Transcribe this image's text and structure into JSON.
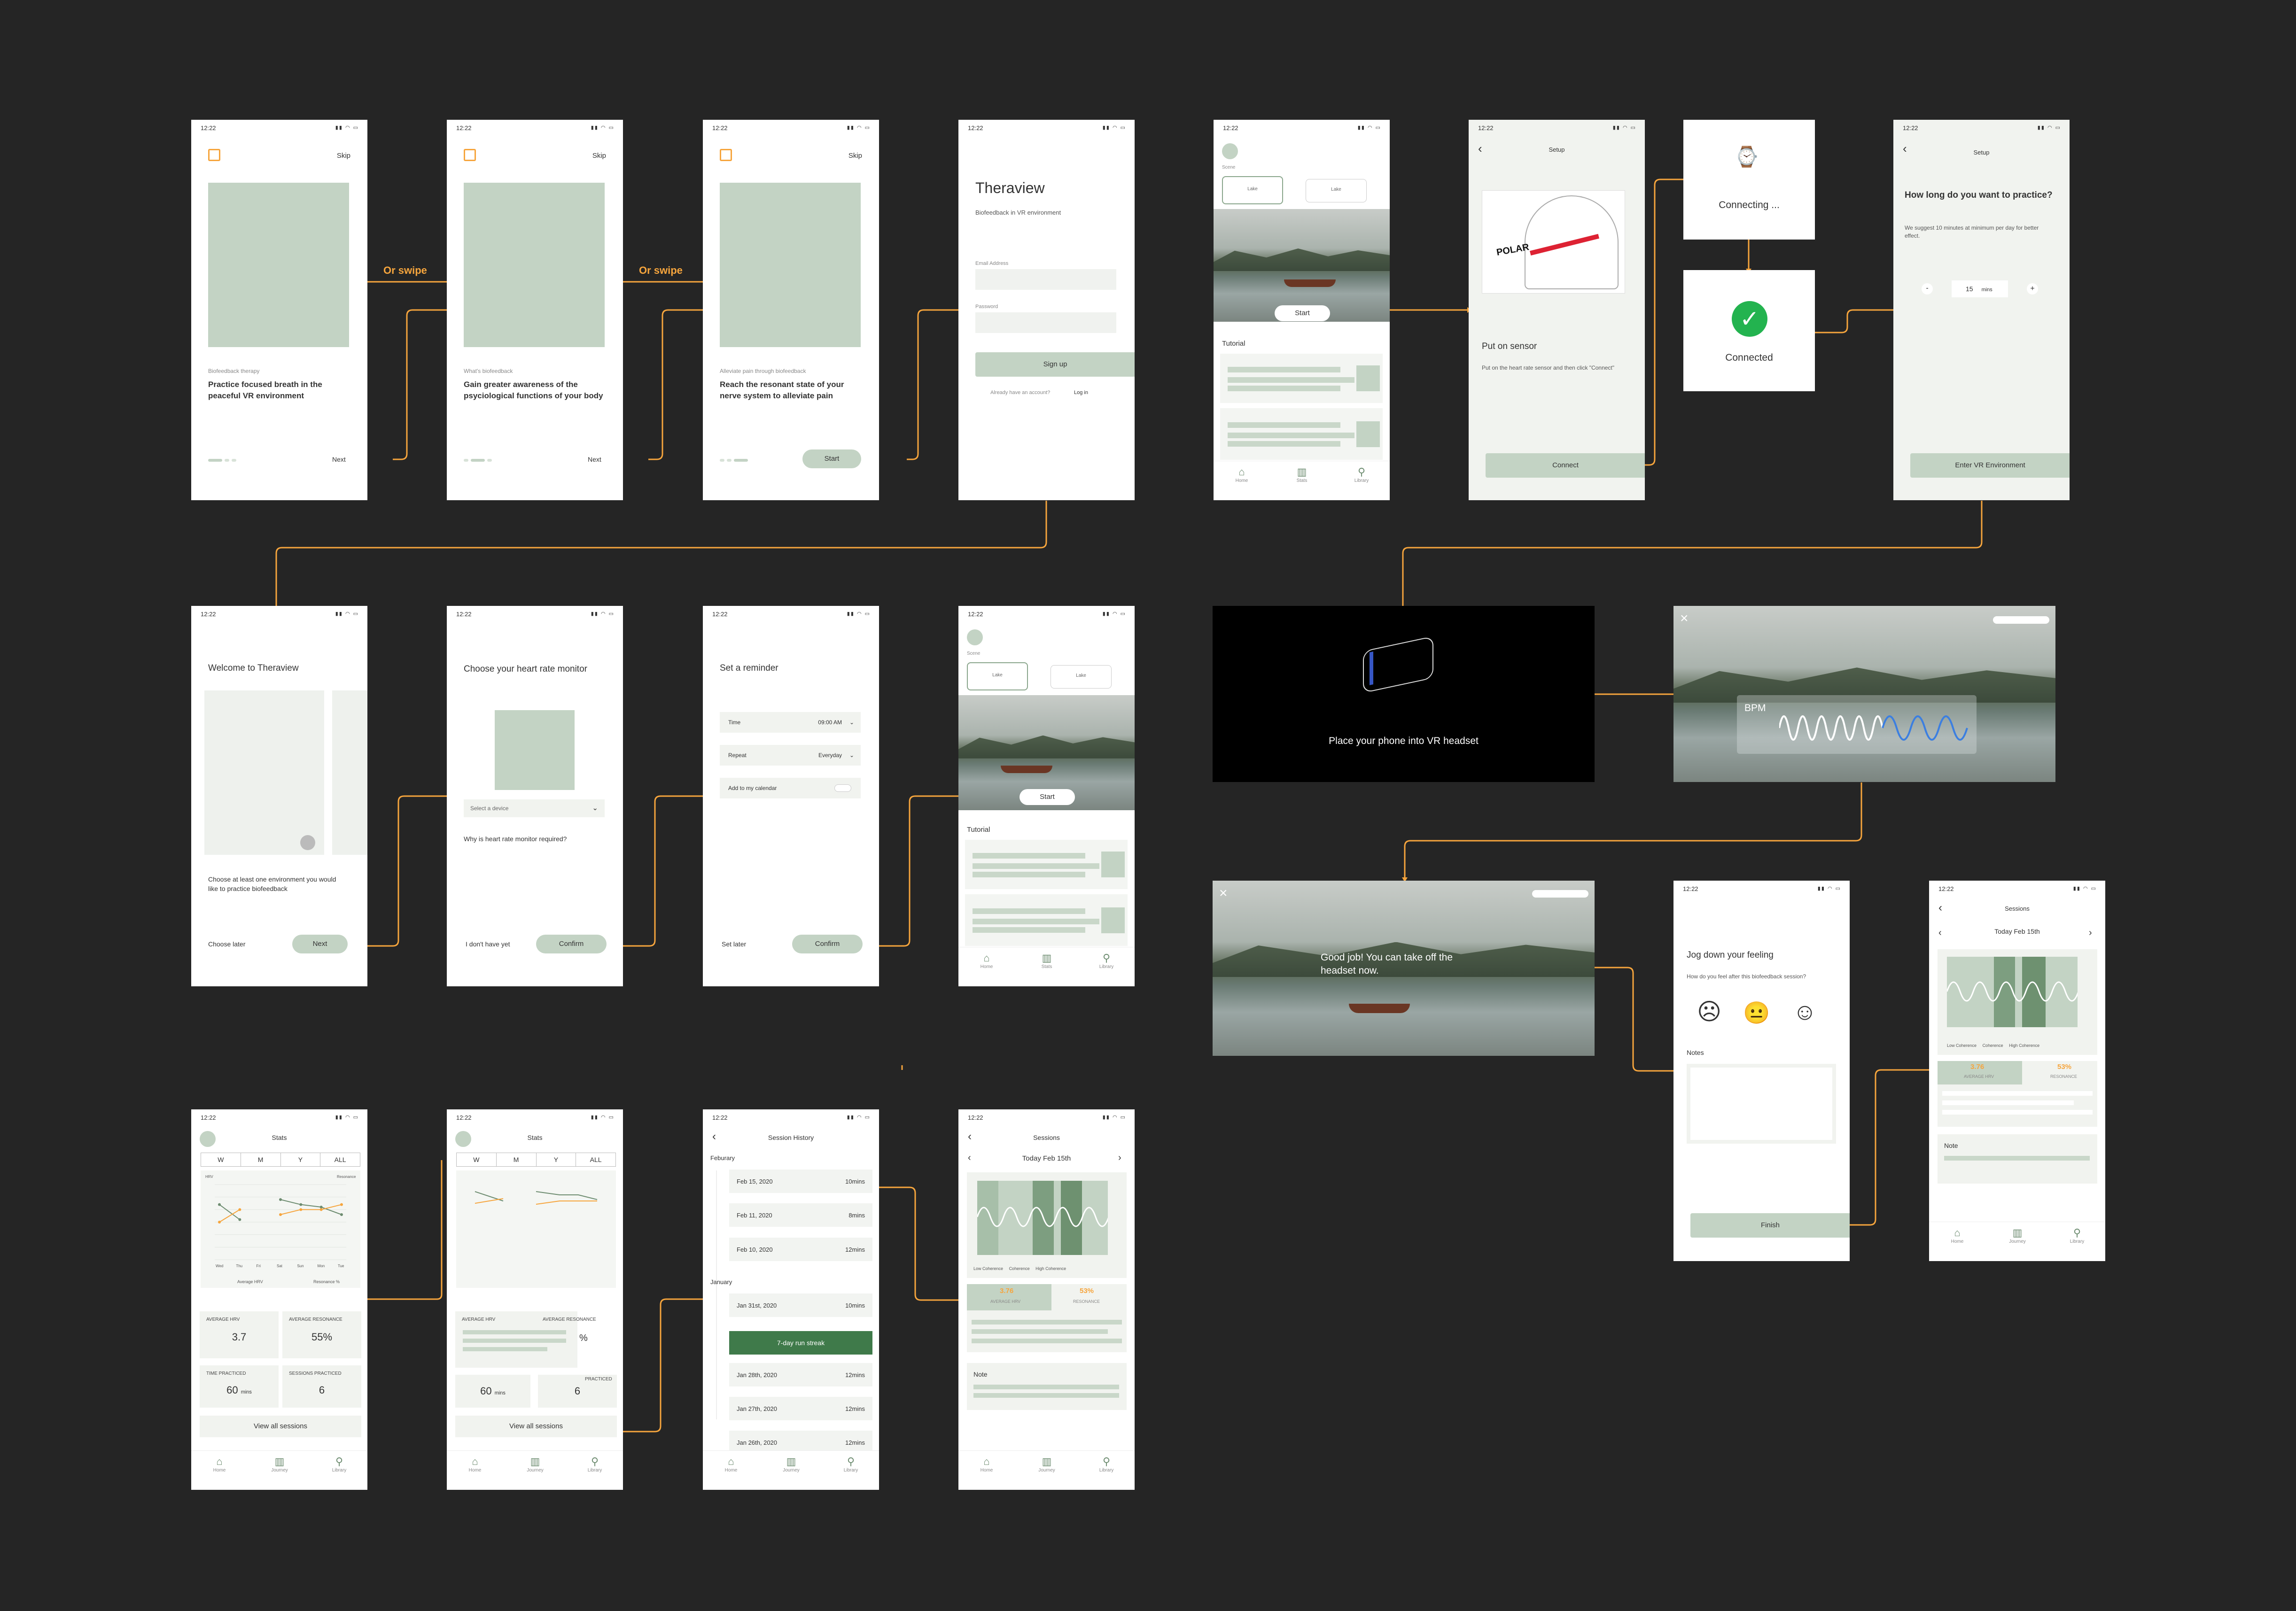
{
  "status": {
    "time": "12:22"
  },
  "common": {
    "skip": "Skip",
    "next": "Next",
    "start": "Start",
    "confirm": "Confirm",
    "connect": "Connect",
    "finish": "Finish",
    "setup": "Setup",
    "scene": "Scene",
    "lake": "Lake",
    "tutorial": "Tutorial",
    "tabs": [
      "Home",
      "Stats",
      "Library"
    ],
    "tabs_journey": [
      "Home",
      "Journey",
      "Library"
    ]
  },
  "flow": {
    "or_swipe": "Or swipe"
  },
  "onboard1": {
    "eyebrow": "Biofeedback therapy",
    "title": "Practice focused breath in the peaceful VR environment"
  },
  "onboard2": {
    "eyebrow": "What's biofeedback",
    "title": "Gain greater awareness of the psyciological functions of your body"
  },
  "onboard3": {
    "eyebrow": "Alleviate pain through biofeedback",
    "title": "Reach the resonant state of your nerve system to alleviate pain"
  },
  "login": {
    "app": "Theraview",
    "tagline": "Biofeedback in VR environment",
    "email": "Email Address",
    "password": "Password",
    "signup": "Sign up",
    "have_account": "Already have an account?",
    "login": "Log in"
  },
  "sensor": {
    "title": "Put on sensor",
    "body": "Put on the heart rate sensor and then click \"Connect\"",
    "brand": "POLAR"
  },
  "connecting": {
    "label": "Connecting ..."
  },
  "connected": {
    "label": "Connected"
  },
  "duration": {
    "title": "How long do you want to practice?",
    "body": "We suggest 10 minutes at minimum per day for better effect.",
    "minus": "-",
    "value": "15",
    "unit": "mins",
    "plus": "+",
    "cta": "Enter VR Environment"
  },
  "welcome": {
    "title": "Welcome to Theraview",
    "body": "Choose at least one environment you would like to practice biofeedback",
    "later": "Choose later"
  },
  "monitor": {
    "title": "Choose your heart rate monitor",
    "select": "Select a device",
    "why": "Why is heart rate monitor required?",
    "none": "I don't have yet"
  },
  "reminder": {
    "title": "Set a reminder",
    "time_label": "Time",
    "time_value": "09:00 AM",
    "repeat_label": "Repeat",
    "repeat_value": "Everyday",
    "calendar": "Add to my calendar",
    "later": "Set later"
  },
  "vr": {
    "place": "Place your phone into VR headset",
    "bpm": "BPM",
    "done": "Good job! You can take off the headset now."
  },
  "feeling": {
    "title": "Jog down your feeling",
    "question": "How do you feel after this biofeedback session?",
    "notes": "Notes",
    "faces": [
      "☹",
      "😐",
      "☺"
    ]
  },
  "sessions": {
    "title": "Sessions",
    "date": "Today Feb 15th",
    "legend": [
      "Low Coherence",
      "Coherence",
      "High Coherence"
    ],
    "hrv_value": "3.76",
    "hrv_label": "AVERAGE HRV",
    "res_value": "53%",
    "res_label": "RESONANCE",
    "note": "Note"
  },
  "stats": {
    "title": "Stats",
    "periods": [
      "W",
      "M",
      "Y",
      "ALL"
    ],
    "y_left": "HRV",
    "y_right": "Resonance",
    "days": [
      "Wed",
      "Thu",
      "Fri",
      "Sat",
      "Sun",
      "Mon",
      "Tue"
    ],
    "legend_hrv": "Average HRV",
    "legend_res": "Resonance %",
    "avg_hrv_label": "AVERAGE HRV",
    "avg_hrv": "3.7",
    "avg_res_label": "AVERAGE RESONANCE",
    "avg_res": "55%",
    "time_label": "TIME PRACTICED",
    "time_value": "60",
    "time_unit": "mins",
    "sessions_label": "SESSIONS PRACTICED",
    "sessions_value": "6",
    "view_all": "View all sessions",
    "practiced": "PRACTICED",
    "pct": "%"
  },
  "history": {
    "title": "Session History",
    "feb": "Feburary",
    "jan": "January",
    "streak": "7-day run streak",
    "feb_rows": [
      [
        "Feb 15, 2020",
        "10mins"
      ],
      [
        "Feb 11, 2020",
        "8mins"
      ],
      [
        "Feb 10, 2020",
        "12mins"
      ]
    ],
    "jan_rows": [
      [
        "Jan 31st, 2020",
        "10mins"
      ],
      [
        "Jan 28th, 2020",
        "12mins"
      ],
      [
        "Jan 27th, 2020",
        "12mins"
      ],
      [
        "Jan 26th, 2020",
        "12mins"
      ]
    ]
  },
  "chart_data": {
    "type": "line",
    "categories": [
      "Wed",
      "Thu",
      "Fri",
      "Sat",
      "Sun",
      "Mon",
      "Tue"
    ],
    "series": [
      {
        "name": "Average HRV",
        "values": [
          4.2,
          3.6,
          null,
          4.4,
          4.2,
          4.1,
          3.8
        ]
      },
      {
        "name": "Resonance %",
        "values": [
          55,
          60,
          null,
          58,
          60,
          60,
          62
        ]
      }
    ],
    "ylabel": "HRV",
    "y2label": "Resonance"
  },
  "colors": {
    "accent": "#f6a53d",
    "sage": "#c3d3c4",
    "dark": "#252525"
  }
}
